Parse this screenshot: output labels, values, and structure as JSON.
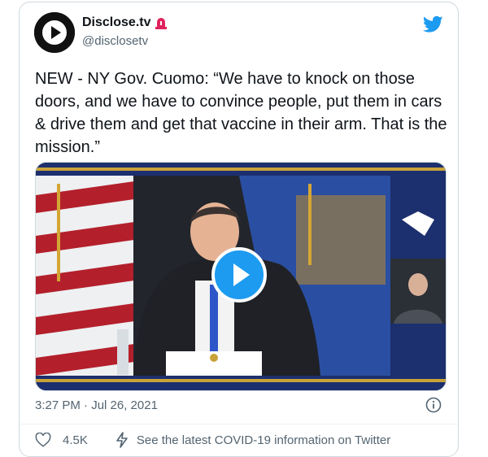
{
  "account": {
    "name": "Disclose.tv",
    "handle": "@disclosetv"
  },
  "tweet": {
    "text": "NEW - NY Gov. Cuomo: “We have to knock on those doors, and we have to convince people, put them in cars & drive them and get that vaccine in their arm. That is the mission.”",
    "timestamp": "3:27 PM · Jul 26, 2021"
  },
  "actions": {
    "like_count": "4.5K",
    "covid_link": "See the latest COVID-19 information on Twitter"
  },
  "icons": {
    "avatar": "play-logo-icon",
    "verified_badge": "siren-icon",
    "platform": "twitter-bird-icon",
    "video": "play-icon",
    "info": "info-icon",
    "like": "heart-icon",
    "covid": "lightning-icon"
  },
  "colors": {
    "accent": "#1d9bf0",
    "text": "#0f1419",
    "muted": "#536471",
    "siren": "#e0245e"
  }
}
